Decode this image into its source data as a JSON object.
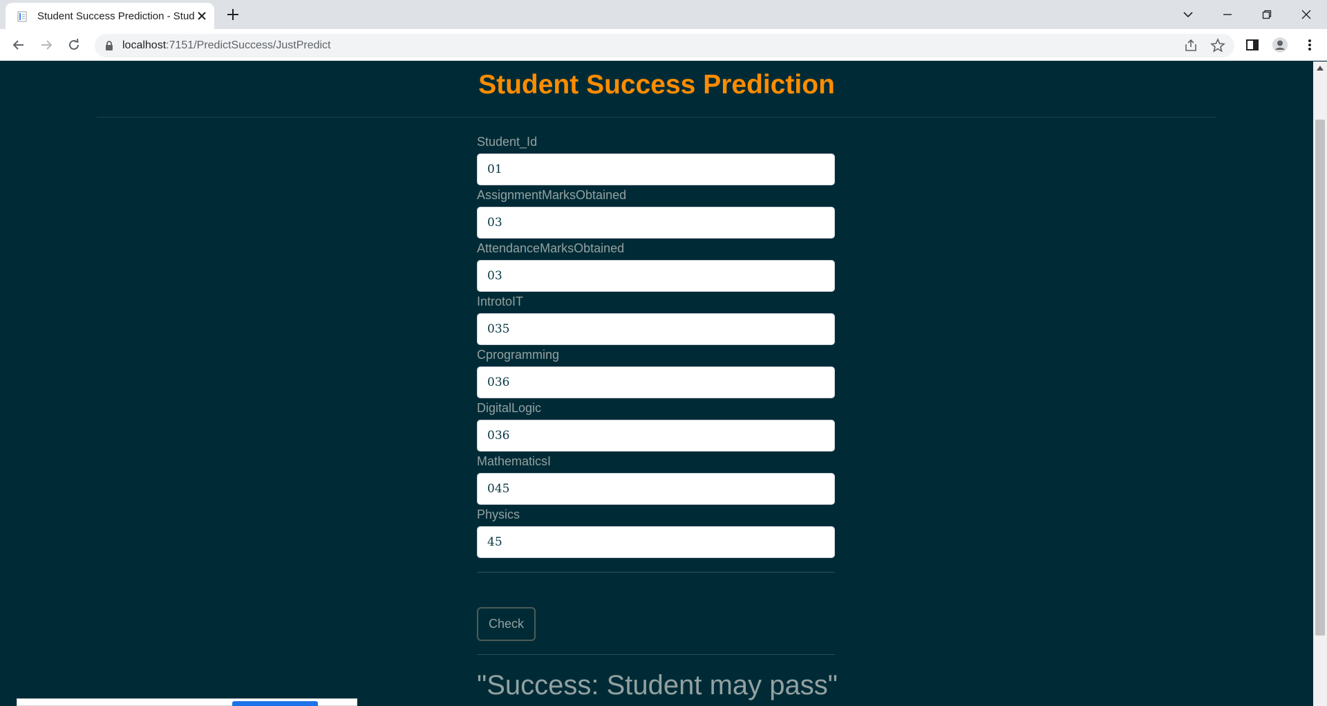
{
  "browser": {
    "tab_title": "Student Success Prediction - Stud",
    "url_host": "localhost",
    "url_path": ":7151/PredictSuccess/JustPredict"
  },
  "page": {
    "title": "Student Success Prediction",
    "fields": [
      {
        "label": "Student_Id",
        "value": "01"
      },
      {
        "label": "AssignmentMarksObtained",
        "value": "03"
      },
      {
        "label": "AttendanceMarksObtained",
        "value": "03"
      },
      {
        "label": "IntrotoIT",
        "value": "035"
      },
      {
        "label": "Cprogramming",
        "value": "036"
      },
      {
        "label": "DigitalLogic",
        "value": "036"
      },
      {
        "label": "MathematicsI",
        "value": "045"
      },
      {
        "label": "Physics",
        "value": "45"
      }
    ],
    "check_label": "Check",
    "result": "\"Success: Student may pass\""
  },
  "colors": {
    "background": "#002b36",
    "title": "#ff8c00",
    "label": "#93a1a1"
  }
}
